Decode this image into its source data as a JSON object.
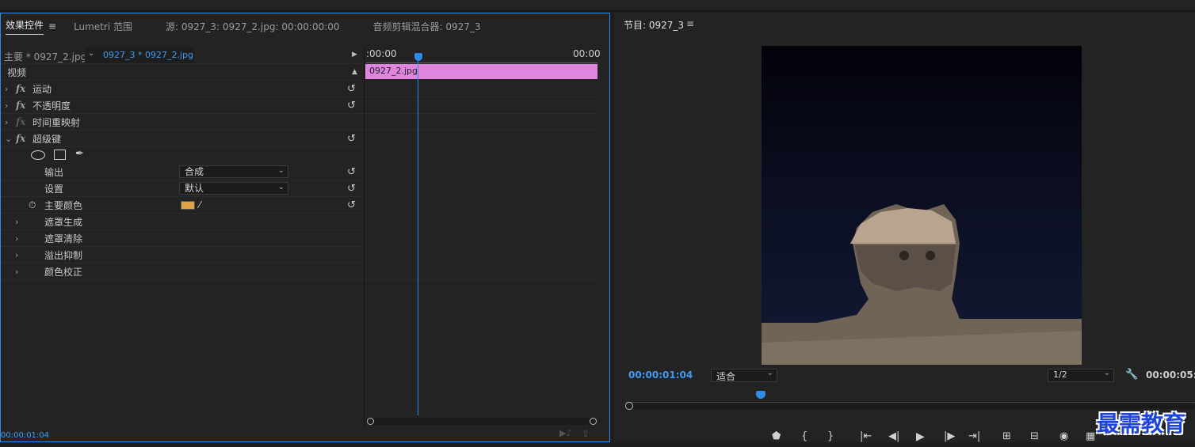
{
  "effects_panel": {
    "tabs": [
      {
        "label": "效果控件",
        "active": true
      },
      {
        "label": "Lumetri 范围"
      },
      {
        "label": "源: 0927_3: 0927_2.jpg: 00:00:00:00"
      },
      {
        "label": "音频剪辑混合器: 0927_3"
      }
    ],
    "menu_icon": "≡",
    "master_clip": "主要 * 0927_2.jpg",
    "sequence_clip": "0927_3 * 0927_2.jpg",
    "video_header": "视频",
    "effects": [
      {
        "label": "运动"
      },
      {
        "label": "不透明度"
      },
      {
        "label": "时间重映射"
      },
      {
        "label": "超级键"
      }
    ],
    "params": {
      "output_label": "输出",
      "output_value": "合成",
      "setting_label": "设置",
      "setting_value": "默认",
      "key_color_label": "主要颜色",
      "key_color": "#e0a447"
    },
    "subgroups": [
      "遮罩生成",
      "遮罩清除",
      "溢出抑制",
      "颜色校正"
    ],
    "timeline": {
      "start": ":00:00",
      "end": "00:00",
      "clip_label": "0927_2.jpg",
      "clip_color": "#e084e0"
    },
    "current_time": "00:00:01:04"
  },
  "program_monitor": {
    "title": "节目: 0927_3",
    "menu_icon": "≡",
    "timecode": "00:00:01:04",
    "zoom": "适合",
    "resolution": "1/2",
    "duration": "00:00:05:"
  },
  "watermark": "最需教育",
  "colors": {
    "accent": "#2d8ceb",
    "timecode": "#3f9cf2"
  }
}
